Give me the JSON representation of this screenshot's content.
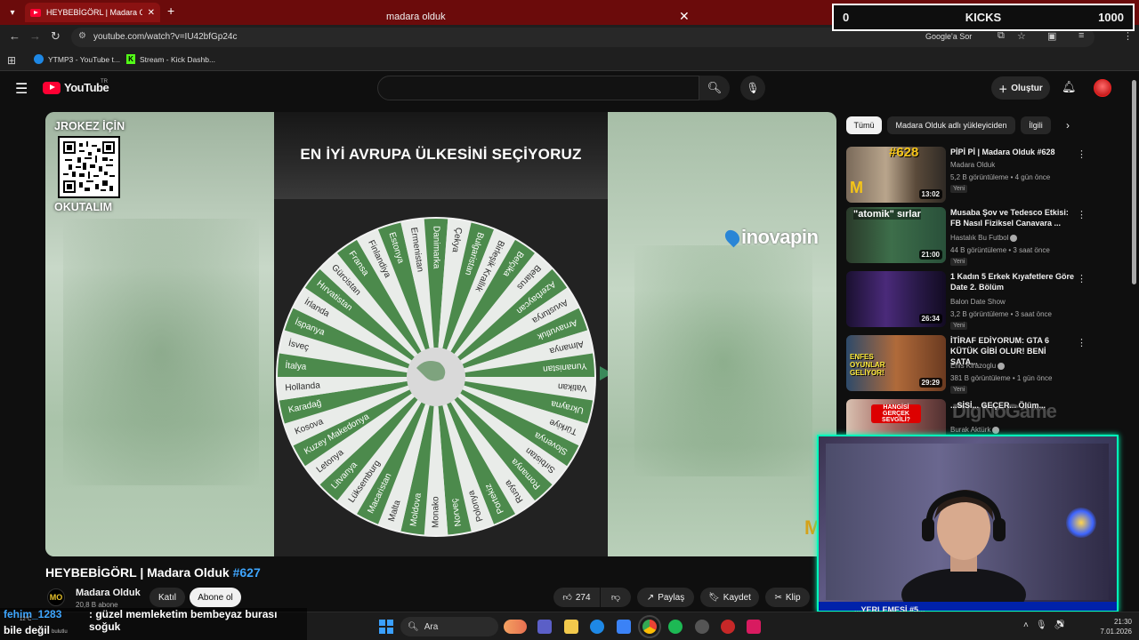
{
  "browser": {
    "tab_title": "HEYBEBİGÖRL | Madara Olduk",
    "url": "youtube.com/watch?v=IU42bfGp24c",
    "google_ask": "Google'a Sor",
    "bookmarks": [
      {
        "label": "YTMP3 - YouTube t..."
      },
      {
        "label": "Stream - Kick Dashb..."
      }
    ]
  },
  "kicks_widget": {
    "left": "0",
    "label": "KICKS",
    "right": "1000"
  },
  "youtube": {
    "logo_text": "YouTube",
    "region": "TR",
    "search": {
      "query": "madara olduk"
    },
    "create_label": "Oluştur"
  },
  "video": {
    "qr_heading": "JROKEZ İÇİN",
    "qr_footer": "OKUTALIM",
    "headline": "EN İYİ AVRUPA ÜLKESİNİ SEÇİYORUZ",
    "sponsor": "inovapin",
    "corner_logo": "M",
    "wheel_countries": [
      "İsveç",
      "İspanya",
      "İrlanda",
      "Hırvatistan",
      "Gürcistan",
      "Fransa",
      "Finlandiya",
      "Estonya",
      "Ermenistan",
      "Danimarka",
      "Çekya",
      "Bulgaristan",
      "Birleşik Krallık",
      "Belçika",
      "Belarus",
      "Azerbaycan",
      "Avusturya",
      "Arnavutluk",
      "Almanya",
      "Yunanistan",
      "Vatikan",
      "Ukrayna",
      "Türkiye",
      "Slovenya",
      "Sırbistan",
      "Romanya",
      "Rusya",
      "Portekiz",
      "Polonya",
      "Norveç",
      "Monako",
      "Moldova",
      "Malta",
      "Macaristan",
      "Lüksemburg",
      "Litvanya",
      "Letonya",
      "Kuzey Makedonya",
      "Kosova",
      "Karadağ",
      "Hollanda",
      "İtalya"
    ]
  },
  "video_info": {
    "title": "HEYBEBİGÖRL | Madara Olduk ",
    "title_tag": "#627",
    "channel_name": "Madara Olduk",
    "channel_avatar_text": "MO",
    "subscribers": "20,8 B abone",
    "join_label": "Katıl",
    "subscribe_label": "Abone ol",
    "likes": "274",
    "share_label": "Paylaş",
    "save_label": "Kaydet",
    "clip_label": "Klip"
  },
  "chips": [
    "Tümü",
    "Madara Olduk adlı yükleyiciden",
    "İlgili"
  ],
  "recommendations": [
    {
      "title": "PİPİ Pİ | Madara Olduk #628",
      "channel": "Madara Olduk",
      "meta": "5,2 B görüntüleme • 4 gün önce",
      "badge": "Yeni",
      "duration": "13:02",
      "thumb_text": "#628"
    },
    {
      "title": "Musaba Şov ve Tedesco Etkisi: FB Nasıl Fiziksel Canavara ...",
      "channel": "Hastalık Bu Futbol",
      "meta": "44 B görüntüleme • 3 saat önce",
      "badge": "Yeni",
      "duration": "21:00",
      "thumb_text": "\"atomik\" sırlar"
    },
    {
      "title": "1 Kadın 5 Erkek Kıyafetlere Göre Date 2. Bölüm",
      "channel": "Balon Date Show",
      "meta": "3,2 B görüntüleme • 3 saat önce",
      "badge": "Yeni",
      "duration": "26:34",
      "thumb_text": ""
    },
    {
      "title": "İTİRAF EDİYORUM: GTA 6 KÜTÜK GİBİ OLUR! BENİ SATA...",
      "channel": "Enis Kirazoglu",
      "meta": "381 B görüntüleme • 1 gün önce",
      "badge": "Yeni",
      "duration": "29:29",
      "thumb_text": "ENFES OYUNLAR GELİYOR!"
    },
    {
      "title": "...SİSİ... GEÇER... Ölüm...",
      "channel": "Burak Aktürk",
      "meta": "",
      "badge": "",
      "duration": "",
      "thumb_text": "HANGİSİ GERÇEK SEVGİLİ?"
    }
  ],
  "watermark": "DigNoGame",
  "bottom_rec_title": "...YERLEMESİ #5...",
  "chat": {
    "user": "fehim_1283",
    "message_line1": ": güzel memleketim bembeyaz burası soğuk",
    "message_line2": "bile değil",
    "weather_temp": "12°C",
    "weather_desc": "bulutlu"
  },
  "taskbar": {
    "search_label": "Ara",
    "time": "21:30",
    "date": "7.01.2026"
  },
  "colors": {
    "accent_red": "#ff0033",
    "link_blue": "#3ea6ff",
    "wheel_green": "#4c8a4c",
    "wheel_light": "#e9ece9",
    "webcam_border": "#00ffbb"
  }
}
